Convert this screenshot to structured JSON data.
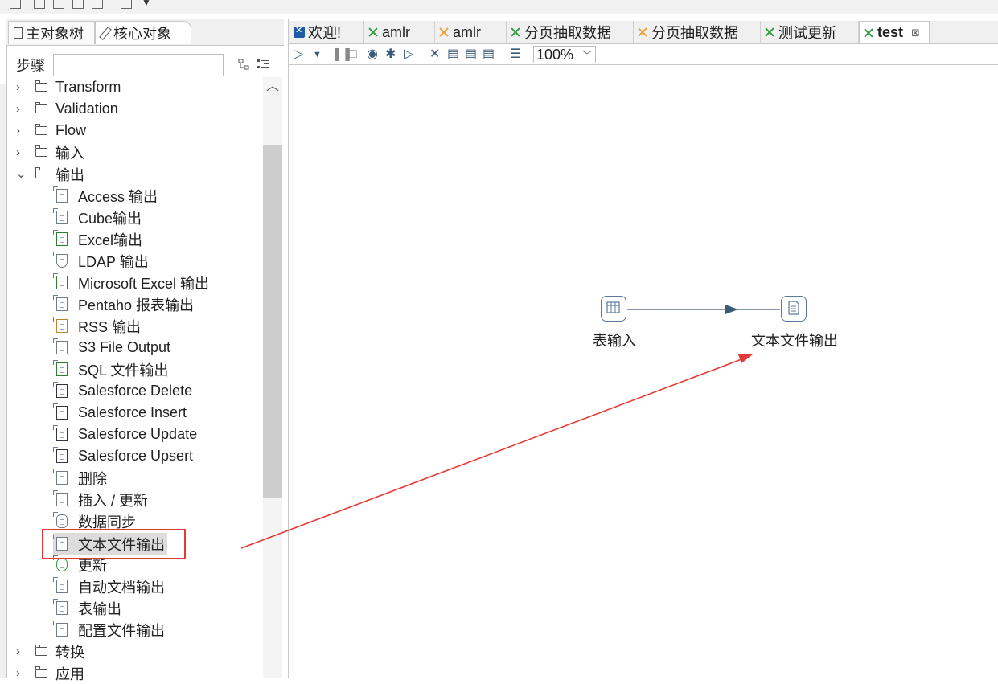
{
  "left_panel": {
    "tabs": [
      {
        "label": "主对象树"
      },
      {
        "label": "核心对象"
      }
    ],
    "search": {
      "label": "步骤",
      "value": ""
    },
    "tree": {
      "folders_top": [
        {
          "label": "Transform"
        },
        {
          "label": "Validation"
        },
        {
          "label": "Flow"
        },
        {
          "label": "输入"
        }
      ],
      "expanded_folder": {
        "label": "输出"
      },
      "steps": [
        {
          "label": "Access 输出"
        },
        {
          "label": "Cube输出"
        },
        {
          "label": "Excel输出"
        },
        {
          "label": "LDAP 输出"
        },
        {
          "label": "Microsoft Excel 输出"
        },
        {
          "label": "Pentaho 报表输出"
        },
        {
          "label": "RSS 输出"
        },
        {
          "label": "S3 File Output"
        },
        {
          "label": "SQL 文件输出"
        },
        {
          "label": "Salesforce Delete"
        },
        {
          "label": "Salesforce Insert"
        },
        {
          "label": "Salesforce Update"
        },
        {
          "label": "Salesforce Upsert"
        },
        {
          "label": "删除"
        },
        {
          "label": "插入 / 更新"
        },
        {
          "label": "数据同步"
        },
        {
          "label": "文本文件输出"
        },
        {
          "label": "更新"
        },
        {
          "label": "自动文档输出"
        },
        {
          "label": "表输出"
        },
        {
          "label": "配置文件输出"
        }
      ],
      "folders_bottom": [
        {
          "label": "转换"
        },
        {
          "label": "应用"
        }
      ]
    }
  },
  "editor": {
    "tabs": [
      {
        "label": "欢迎!",
        "icon": "welcome-icon"
      },
      {
        "label": "amlr",
        "icon": "transformation-icon"
      },
      {
        "label": "amlr",
        "icon": "job-icon"
      },
      {
        "label": "分页抽取数据",
        "icon": "transformation-icon"
      },
      {
        "label": "分页抽取数据",
        "icon": "job-icon"
      },
      {
        "label": "测试更新",
        "icon": "transformation-icon"
      },
      {
        "label": "test",
        "icon": "transformation-icon",
        "active": true
      }
    ],
    "zoom": "100%",
    "canvas": {
      "nodes": [
        {
          "label": "表输入"
        },
        {
          "label": "文本文件输出"
        }
      ]
    }
  },
  "colors": {
    "highlight": "#e53935",
    "arrow": "#e53935",
    "hop": "#3d5a78"
  }
}
